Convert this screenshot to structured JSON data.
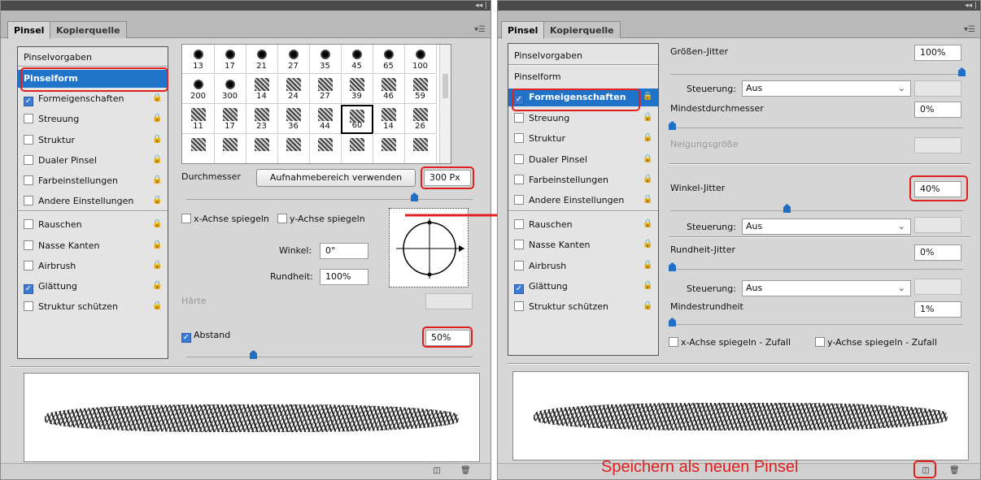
{
  "colors": {
    "accent": "#1f73c9",
    "highlight": "#e0201f"
  },
  "left": {
    "tabs": [
      "Pinsel",
      "Kopierquelle"
    ],
    "presets_label": "Pinselvorgaben",
    "list": [
      {
        "label": "Pinselform",
        "checkbox": false,
        "selected": true
      },
      {
        "label": "Formeigenschaften",
        "checkbox": true,
        "checked": true
      },
      {
        "label": "Streuung",
        "checkbox": true,
        "checked": false
      },
      {
        "label": "Struktur",
        "checkbox": true,
        "checked": false
      },
      {
        "label": "Dualer Pinsel",
        "checkbox": true,
        "checked": false
      },
      {
        "label": "Farbeinstellungen",
        "checkbox": true,
        "checked": false
      },
      {
        "label": "Andere Einstellungen",
        "checkbox": true,
        "checked": false
      },
      {
        "label": "Rauschen",
        "checkbox": true,
        "checked": false
      },
      {
        "label": "Nasse Kanten",
        "checkbox": true,
        "checked": false
      },
      {
        "label": "Airbrush",
        "checkbox": true,
        "checked": false
      },
      {
        "label": "Glättung",
        "checkbox": true,
        "checked": true
      },
      {
        "label": "Struktur schützen",
        "checkbox": true,
        "checked": false
      }
    ],
    "brushes": [
      "13",
      "17",
      "21",
      "27",
      "35",
      "45",
      "65",
      "100",
      "200",
      "300",
      "14",
      "24",
      "27",
      "39",
      "46",
      "59",
      "11",
      "17",
      "23",
      "36",
      "44",
      "60",
      "14",
      "26"
    ],
    "diameter_label": "Durchmesser",
    "sample_button": "Aufnahmebereich verwenden",
    "diameter_value": "300 Px",
    "flip_x": "x-Achse spiegeln",
    "flip_y": "y-Achse spiegeln",
    "angle_label": "Winkel:",
    "angle_value": "0°",
    "roundness_label": "Rundheit:",
    "roundness_value": "100%",
    "hardness_label": "Härte",
    "spacing_label": "Abstand",
    "spacing_value": "50%"
  },
  "right": {
    "tabs": [
      "Pinsel",
      "Kopierquelle"
    ],
    "presets_label": "Pinselvorgaben",
    "list": [
      {
        "label": "Pinselform",
        "checkbox": false,
        "selected": false
      },
      {
        "label": "Formeigenschaften",
        "checkbox": true,
        "checked": true,
        "selected": true
      },
      {
        "label": "Streuung",
        "checkbox": true,
        "checked": false
      },
      {
        "label": "Struktur",
        "checkbox": true,
        "checked": false
      },
      {
        "label": "Dualer Pinsel",
        "checkbox": true,
        "checked": false
      },
      {
        "label": "Farbeinstellungen",
        "checkbox": true,
        "checked": false
      },
      {
        "label": "Andere Einstellungen",
        "checkbox": true,
        "checked": false
      },
      {
        "label": "Rauschen",
        "checkbox": true,
        "checked": false
      },
      {
        "label": "Nasse Kanten",
        "checkbox": true,
        "checked": false
      },
      {
        "label": "Airbrush",
        "checkbox": true,
        "checked": false
      },
      {
        "label": "Glättung",
        "checkbox": true,
        "checked": true
      },
      {
        "label": "Struktur schützen",
        "checkbox": true,
        "checked": false
      }
    ],
    "size_jitter_label": "Größen-Jitter",
    "size_jitter_value": "100%",
    "control_label": "Steuerung:",
    "control_value": "Aus",
    "min_diameter_label": "Mindestdurchmesser",
    "min_diameter_value": "0%",
    "tilt_label": "Neigungsgröße",
    "angle_jitter_label": "Winkel-Jitter",
    "angle_jitter_value": "40%",
    "roundness_jitter_label": "Rundheit-Jitter",
    "roundness_jitter_value": "0%",
    "min_roundness_label": "Mindestrundheit",
    "min_roundness_value": "1%",
    "flip_x_random": "x-Achse spiegeln - Zufall",
    "flip_y_random": "y-Achse spiegeln - Zufall",
    "save_note": "Speichern als neuen Pinsel"
  }
}
